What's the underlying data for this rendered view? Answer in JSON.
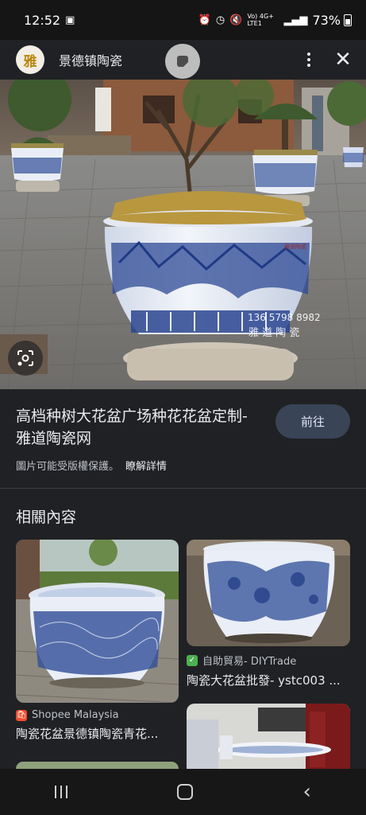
{
  "status": {
    "time": "12:52",
    "network": "Vo) 4G+ LTE1",
    "battery_pct": "73%"
  },
  "appbar": {
    "site_logo_text": "雅",
    "site_name": "景德镇陶瓷"
  },
  "hero": {
    "watermark_phone": "136 5798 8982",
    "watermark_name": "雅 道 陶 瓷",
    "pot_label": "雅道陶瓷"
  },
  "result": {
    "title": "高档种树大花盆广场种花花盆定制- 雅道陶瓷网",
    "visit_label": "前往",
    "copyright_note": "圖片可能受版權保護。",
    "learn_more": "瞭解詳情"
  },
  "related": {
    "heading": "相關內容",
    "items": [
      {
        "source": "Shopee Malaysia",
        "title": "陶瓷花盆景德镇陶瓷青花...",
        "favicon_color": "#ee4d2d"
      },
      {
        "source": "自助貿易- DIYTrade",
        "title": "陶瓷大花盆批發- ystc003 ...",
        "favicon_color": "#4caf50"
      }
    ]
  },
  "icons": {
    "float": "screenshot-tool-icon",
    "lens": "google-lens-icon",
    "menu": "more-vert-icon",
    "close": "close-icon"
  }
}
